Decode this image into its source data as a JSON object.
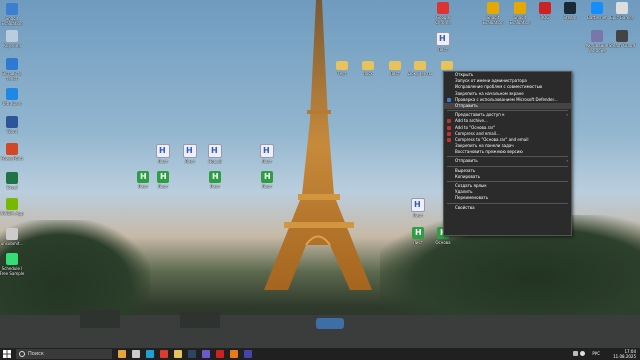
{
  "wallpaper": {
    "subject": "eiffel-tower-at-dusk"
  },
  "desktop_icons_left": [
    {
      "label": "Snagit Evaluation",
      "icon": "app-icon",
      "color": "#3b7fd1"
    },
    {
      "label": "Корзина",
      "icon": "recycle-bin-icon",
      "color": "#bcd"
    },
    {
      "label": "Вставить текст",
      "icon": "app-icon",
      "color": "#2f7ad1"
    },
    {
      "label": "UltraCam",
      "icon": "app-icon",
      "color": "#1e88e5"
    },
    {
      "label": "Word",
      "icon": "word-icon",
      "color": "#2b579a"
    },
    {
      "label": "PowerPoint",
      "icon": "powerpoint-icon",
      "color": "#d24726"
    },
    {
      "label": "Excel",
      "icon": "excel-icon",
      "color": "#217346"
    },
    {
      "label": "NVIDIA App",
      "icon": "nvidia-icon",
      "color": "#76b900"
    },
    {
      "label": "unsubmit...",
      "icon": "file-icon",
      "color": "#ccc"
    },
    {
      "label": "Schedule I Free Sample",
      "icon": "game-icon",
      "color": "#3d7"
    }
  ],
  "desktop_icons_top": [
    {
      "label": "Google Chrome",
      "icon": "chrome-icon",
      "color": "#d33"
    },
    {
      "label": "Snagit Evaluation",
      "icon": "app-icon",
      "color": "#e6a800"
    },
    {
      "label": "Snagit Evaluation",
      "icon": "app-icon",
      "color": "#e6a800"
    },
    {
      "label": "ROG",
      "icon": "app-icon",
      "color": "#c22"
    },
    {
      "label": "Steam",
      "icon": "steam-icon",
      "color": "#1b2838"
    },
    {
      "label": "Battle.net",
      "icon": "app-icon",
      "color": "#148eff"
    },
    {
      "label": "Epic Games",
      "icon": "app-icon",
      "color": "#ddd"
    }
  ],
  "desktop_icons_right": [
    {
      "label": "Активация Windows",
      "icon": "app-icon",
      "color": "#77a"
    },
    {
      "label": "Steam Guard",
      "icon": "steam-icon",
      "color": "#444"
    }
  ],
  "file_icons": [
    {
      "label": "Лист",
      "type": "doc"
    },
    {
      "label": "Лист",
      "type": "doc"
    },
    {
      "label": "Новый",
      "type": "doc"
    },
    {
      "label": "Лист",
      "type": "doc"
    },
    {
      "label": "Лист",
      "type": "green"
    },
    {
      "label": "Лист",
      "type": "green"
    },
    {
      "label": "Лист",
      "type": "green"
    },
    {
      "label": "Лист",
      "type": "green"
    },
    {
      "label": "Тест",
      "type": "folder"
    },
    {
      "label": "docx",
      "type": "folder"
    },
    {
      "label": "Лист",
      "type": "folder"
    },
    {
      "label": "Документы",
      "type": "folder"
    },
    {
      "label": "Лист",
      "type": "folder"
    },
    {
      "label": "Лист",
      "type": "doc"
    },
    {
      "label": "Лист",
      "type": "green"
    },
    {
      "label": "Основа",
      "type": "green"
    },
    {
      "label": "Лист",
      "type": "doc"
    }
  ],
  "context_menu": {
    "items": [
      {
        "label": "Открыть",
        "icon": ""
      },
      {
        "label": "Запуск от имени администратора",
        "icon": ""
      },
      {
        "label": "Исправление проблем с совместимостью",
        "icon": ""
      },
      {
        "label": "Закрепить на начальном экране",
        "icon": ""
      },
      {
        "label": "Проверка с использованием Microsoft Defender...",
        "icon": "defender-icon",
        "color": "#3a7bd5"
      },
      {
        "label": "Отправить",
        "icon": "",
        "highlight": true
      },
      {
        "sep": true
      },
      {
        "label": "Предоставить доступ к",
        "icon": "",
        "submenu": true
      },
      {
        "label": "Add to archive...",
        "icon": "archive-icon",
        "color": "#b33"
      },
      {
        "label": "Add to \"Основа.rar\"",
        "icon": "archive-icon",
        "color": "#b33"
      },
      {
        "label": "Compress and email...",
        "icon": "archive-icon",
        "color": "#b33"
      },
      {
        "label": "Compress to \"Основа.rar\" and email",
        "icon": "archive-icon",
        "color": "#b33"
      },
      {
        "label": "Закрепить на панели задач",
        "icon": ""
      },
      {
        "label": "Восстановить прежнюю версию",
        "icon": ""
      },
      {
        "sep": true
      },
      {
        "label": "Отправить",
        "icon": "",
        "submenu": true
      },
      {
        "sep": true
      },
      {
        "label": "Вырезать",
        "icon": ""
      },
      {
        "label": "Копировать",
        "icon": ""
      },
      {
        "sep": true
      },
      {
        "label": "Создать ярлык",
        "icon": ""
      },
      {
        "label": "Удалить",
        "icon": ""
      },
      {
        "label": "Переименовать",
        "icon": ""
      },
      {
        "sep": true
      },
      {
        "label": "Свойства",
        "icon": ""
      }
    ]
  },
  "taskbar": {
    "search_placeholder": "Поиск",
    "apps": [
      {
        "icon": "weather-icon",
        "color": "#e9a43b"
      },
      {
        "icon": "task-view-icon",
        "color": "#ccc"
      },
      {
        "icon": "edge-icon",
        "color": "#1ca0d6"
      },
      {
        "icon": "chrome-icon",
        "color": "#dc3b2f"
      },
      {
        "icon": "explorer-icon",
        "color": "#e8c25a"
      },
      {
        "icon": "steam-icon",
        "color": "#2a475e"
      },
      {
        "icon": "app-icon",
        "color": "#6a5acd"
      },
      {
        "icon": "app-icon",
        "color": "#c22"
      },
      {
        "icon": "app-icon",
        "color": "#e87a1a"
      },
      {
        "icon": "app-icon",
        "color": "#44a"
      }
    ],
    "tray_lang": "РУС",
    "time": "17:04",
    "date": "11.08.2025"
  }
}
